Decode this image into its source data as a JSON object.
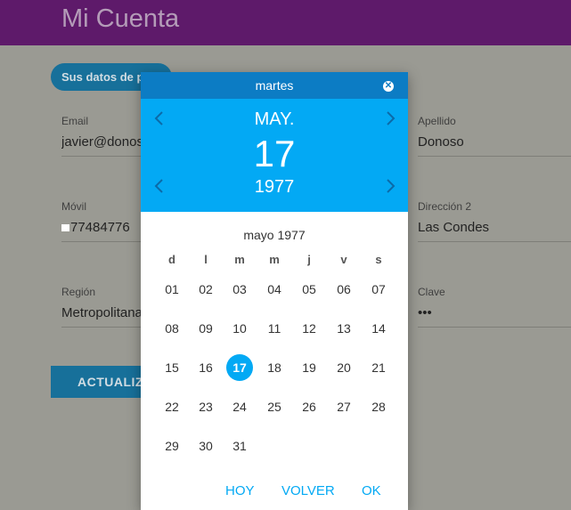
{
  "header": {
    "title": "Mi Cuenta"
  },
  "form": {
    "chip_label": "Sus datos de p",
    "email": {
      "label": "Email",
      "value": "javier@donos"
    },
    "movil": {
      "label": "Móvil",
      "value": "77484776"
    },
    "region": {
      "label": "Región",
      "value": "Metropolitana"
    },
    "apellido": {
      "label": "Apellido",
      "value": "Donoso"
    },
    "direccion2": {
      "label": "Dirección 2",
      "value": "Las Condes"
    },
    "clave": {
      "label": "Clave",
      "value": "•••"
    },
    "update_label": "ACTUALIZ"
  },
  "datepicker": {
    "weekday": "martes",
    "month": "MAY.",
    "day": "17",
    "year": "1977",
    "calendar_title": "mayo 1977",
    "weekdays": [
      "d",
      "l",
      "m",
      "m",
      "j",
      "v",
      "s"
    ],
    "weeks": [
      [
        "01",
        "02",
        "03",
        "04",
        "05",
        "06",
        "07"
      ],
      [
        "08",
        "09",
        "10",
        "11",
        "12",
        "13",
        "14"
      ],
      [
        "15",
        "16",
        "17",
        "18",
        "19",
        "20",
        "21"
      ],
      [
        "22",
        "23",
        "24",
        "25",
        "26",
        "27",
        "28"
      ],
      [
        "29",
        "30",
        "31"
      ]
    ],
    "selected_day": "17",
    "buttons": {
      "today": "HOY",
      "back": "VOLVER",
      "ok": "OK"
    },
    "colors": {
      "accent": "#03a9f4",
      "top_bar": "#0c7cc4"
    },
    "icons": {
      "close": "close-icon",
      "prev": "chevron-left-icon",
      "next": "chevron-right-icon"
    }
  }
}
